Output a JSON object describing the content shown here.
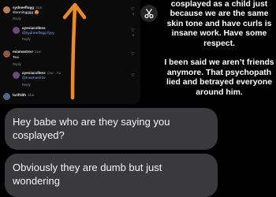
{
  "comments_screenshot": {
    "comments": [
      {
        "username": "sydneeflogg",
        "age": "11w",
        "text": "stunningggg",
        "emoji": "😍",
        "likes": "9",
        "reply_label": "Reply",
        "avatar_color": "#b57d5a"
      },
      {
        "username": "ayesiacolless",
        "age": "",
        "text": "@sydneeflogg fyyy",
        "mention": "@sydneeflogg",
        "likes": "9",
        "reply_label": "Reply",
        "avatar_color": "#6a4a7a"
      },
      {
        "username": "miamastrov",
        "age": "11w",
        "text": "Tea",
        "likes": "",
        "reply_label": "Reply",
        "avatar_color": "#8c5a3c"
      },
      {
        "username": "ayesiacolless",
        "age": "11w · Au",
        "text": "@miamastrov",
        "mention": "@miamastrov",
        "likes": "",
        "reply_label": "Reply",
        "avatar_color": "#6a4a7a"
      },
      {
        "username": "lariftdth",
        "age": "11w",
        "text": "",
        "likes": "",
        "reply_label": "",
        "avatar_color": "#4a6a8a"
      }
    ],
    "arrow_color": "#f08a1e"
  },
  "caption": {
    "text": "cosplayed as a child just because we are the same skin tone and have curls is insane work. Have some respect.\n\nI been said we aren’t friends anymore. That psychopath lied and betrayed everyone around him."
  },
  "chat": {
    "messages": [
      {
        "text": "Hey babe who are they saying you cosplayed?"
      },
      {
        "text": "Obviously they are dumb but just wondering"
      }
    ]
  }
}
